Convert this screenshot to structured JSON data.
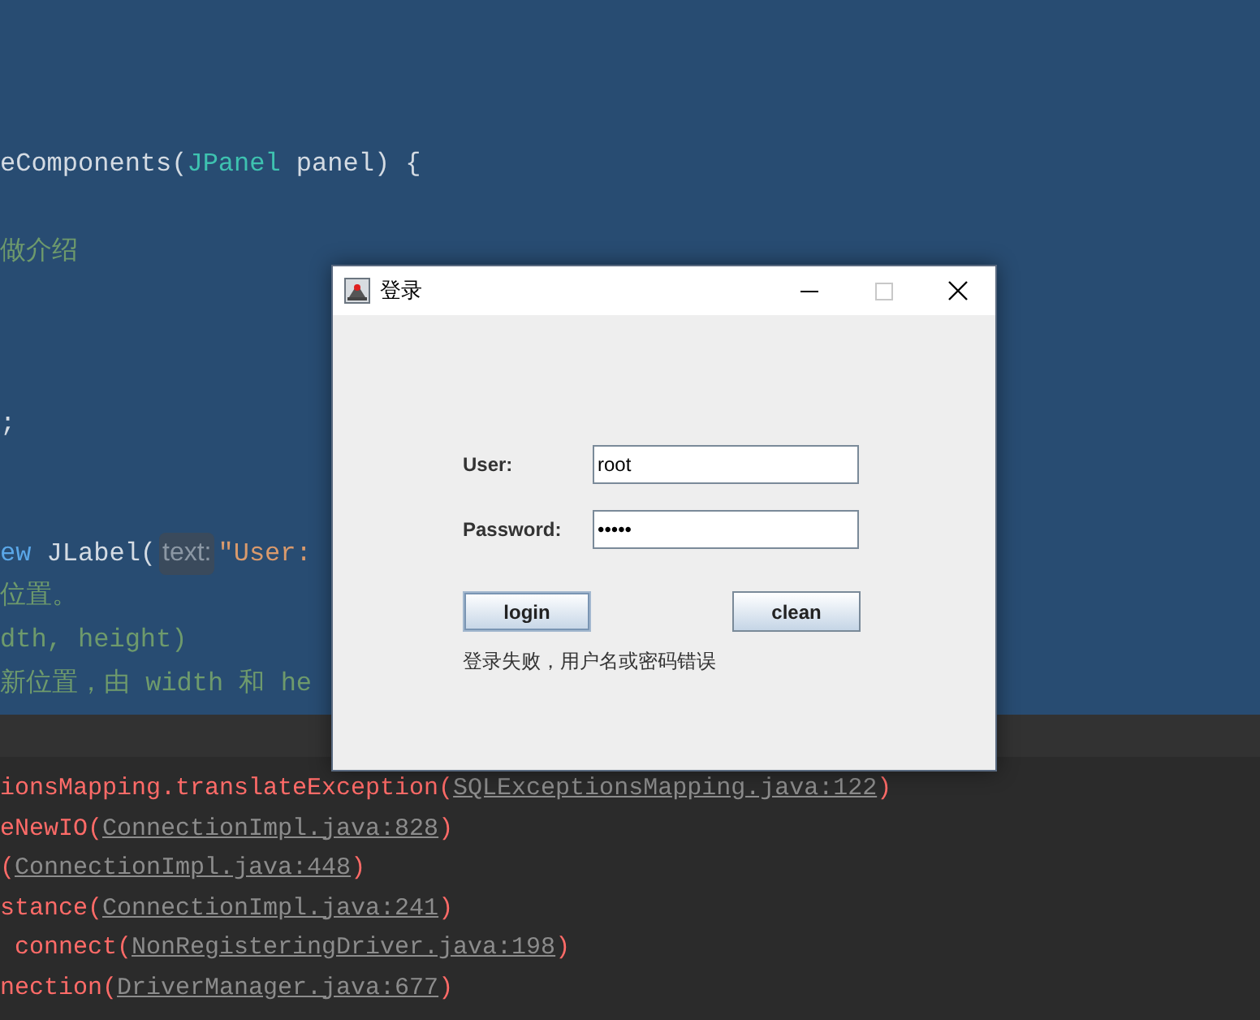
{
  "editor": {
    "lines": [
      {
        "kind": "blank"
      },
      {
        "kind": "blank"
      },
      {
        "kind": "blank"
      },
      {
        "kind": "blank"
      },
      {
        "kind": "code",
        "segments": [
          {
            "text": "eComponents(",
            "kind": "plain"
          },
          {
            "text": "JPanel",
            "kind": "type"
          },
          {
            "text": " panel) {",
            "kind": "plain"
          }
        ]
      },
      {
        "kind": "blank"
      },
      {
        "kind": "code",
        "segments": [
          {
            "text": "做介绍",
            "kind": "comment"
          }
        ]
      },
      {
        "kind": "blank"
      },
      {
        "kind": "blank"
      },
      {
        "kind": "blank"
      },
      {
        "kind": "code",
        "segments": [
          {
            "text": ";",
            "kind": "plain"
          }
        ]
      },
      {
        "kind": "blank"
      },
      {
        "kind": "blank"
      },
      {
        "kind": "code",
        "segments": [
          {
            "text": "ew",
            "kind": "keyword"
          },
          {
            "text": " JLabel(",
            "kind": "plain"
          },
          {
            "text": "text:",
            "kind": "hint"
          },
          {
            "text": "\"User:",
            "kind": "string"
          }
        ]
      },
      {
        "kind": "code",
        "segments": [
          {
            "text": "位置。",
            "kind": "comment"
          }
        ]
      },
      {
        "kind": "code",
        "segments": [
          {
            "text": "dth, height)",
            "kind": "comment"
          }
        ]
      },
      {
        "kind": "code",
        "segments": [
          {
            "text": "新位置，由 width 和 he",
            "kind": "comment"
          }
        ]
      }
    ]
  },
  "console": {
    "lines": [
      {
        "segments": [
          {
            "text": "ionsMapping.translateException(",
            "kind": "error"
          },
          {
            "text": "SQLExceptionsMapping.java:122",
            "kind": "link"
          },
          {
            "text": ")",
            "kind": "error"
          }
        ]
      },
      {
        "segments": [
          {
            "text": "eNewIO(",
            "kind": "error"
          },
          {
            "text": "ConnectionImpl.java:828",
            "kind": "link"
          },
          {
            "text": ")",
            "kind": "error"
          }
        ]
      },
      {
        "segments": [
          {
            "text": "(",
            "kind": "error"
          },
          {
            "text": "ConnectionImpl.java:448",
            "kind": "link"
          },
          {
            "text": ")",
            "kind": "error"
          }
        ]
      },
      {
        "segments": [
          {
            "text": "stance(",
            "kind": "error"
          },
          {
            "text": "ConnectionImpl.java:241",
            "kind": "link"
          },
          {
            "text": ")",
            "kind": "error"
          }
        ]
      },
      {
        "segments": [
          {
            "text": " connect(",
            "kind": "error"
          },
          {
            "text": "NonRegisteringDriver.java:198",
            "kind": "link"
          },
          {
            "text": ")",
            "kind": "error"
          }
        ]
      },
      {
        "segments": [
          {
            "text": "nection(",
            "kind": "error"
          },
          {
            "text": "DriverManager.java:677",
            "kind": "link"
          },
          {
            "text": ")",
            "kind": "error"
          }
        ]
      }
    ]
  },
  "dialog": {
    "title": "登录",
    "fields": [
      {
        "label": "User:",
        "value": "root"
      },
      {
        "label": "Password:",
        "value": "•••••"
      }
    ],
    "buttons": [
      {
        "label": "login",
        "focused": true
      },
      {
        "label": "clean",
        "focused": false
      }
    ],
    "message": "登录失败，用户名或密码错误"
  }
}
